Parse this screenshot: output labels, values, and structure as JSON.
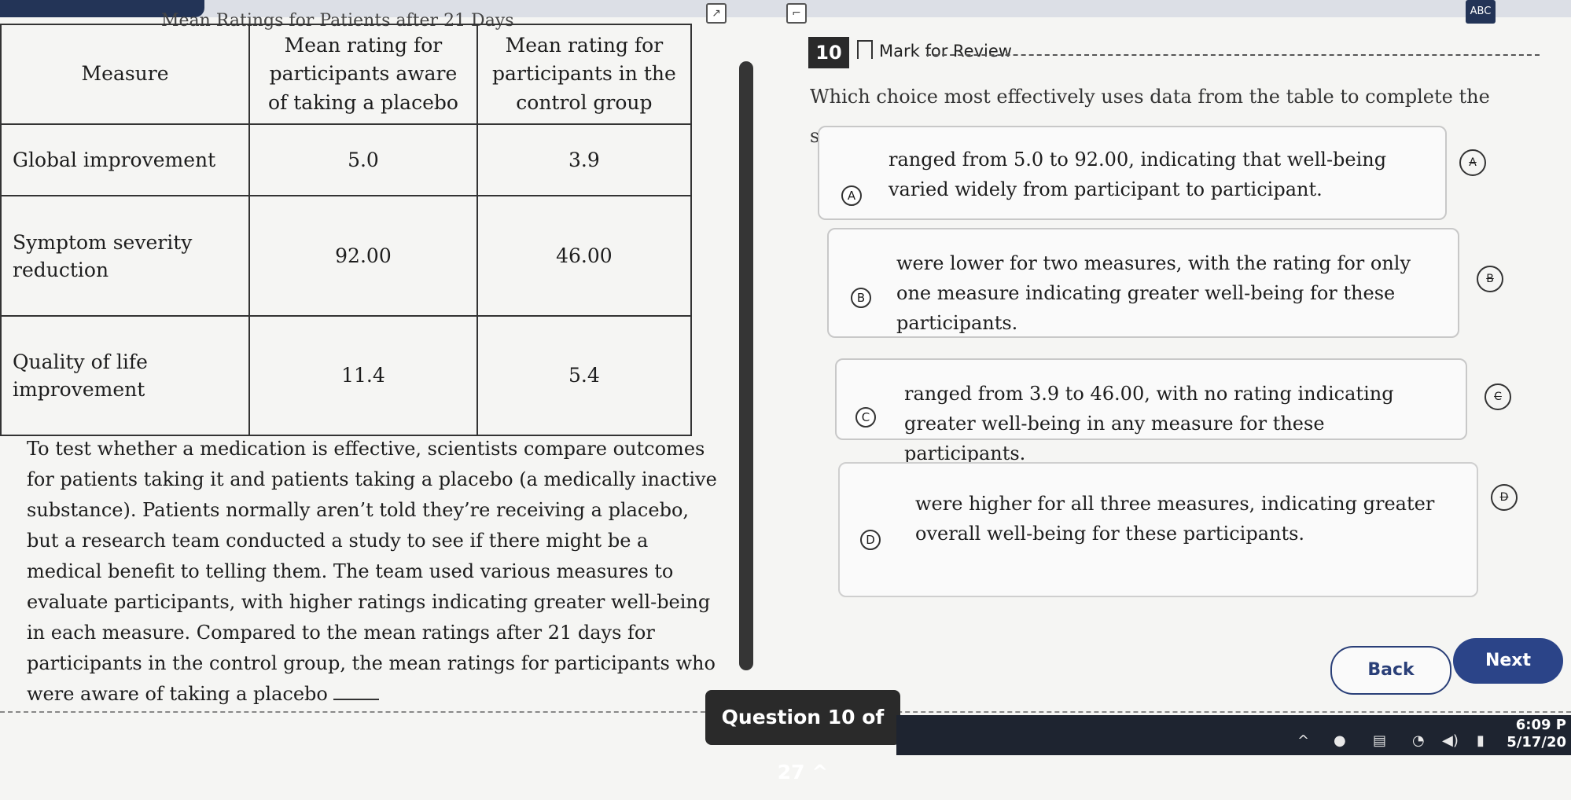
{
  "table": {
    "title": "Mean Ratings for Patients after 21 Days",
    "headers": [
      "Measure",
      "Mean rating for participants aware of taking a placebo",
      "Mean rating for participants in the control group"
    ],
    "rows": [
      {
        "measure": "Global improvement",
        "placebo": "5.0",
        "control": "3.9"
      },
      {
        "measure": "Symptom severity reduction",
        "placebo": "92.00",
        "control": "46.00"
      },
      {
        "measure": "Quality of life improvement",
        "placebo": "11.4",
        "control": "5.4"
      }
    ]
  },
  "passage": {
    "text": "To test whether a medication is effective, scientists compare outcomes for patients taking it and patients taking a placebo (a medically inactive substance). Patients normally aren’t told they’re receiving a placebo, but a research team conducted a study to see if there might be a medical benefit to telling them. The team used various measures to evaluate participants, with higher ratings indicating greater well-being in each measure. Compared to the mean ratings after 21 days for participants in the control group, the mean ratings for participants who were aware of taking a placebo"
  },
  "question": {
    "number": "10",
    "mark_label": "Mark for Review",
    "prompt": "Which choice most effectively uses data from the table to complete the statement?",
    "choices": [
      {
        "letter": "A",
        "text": "ranged from 5.0 to 92.00, indicating that well-being varied widely from participant to participant."
      },
      {
        "letter": "B",
        "text": "were lower for two measures, with the rating for only one measure indicating greater well-being for these participants."
      },
      {
        "letter": "C",
        "text": "ranged from 3.9 to 46.00, with no rating indicating greater well-being in any measure for these participants."
      },
      {
        "letter": "D",
        "text": "were higher for all three measures, indicating greater overall well-being for these participants."
      }
    ]
  },
  "toolbar": {
    "abc_label": "ABC",
    "expand_icon": "expand-icon",
    "collapse_icon": "collapse-icon"
  },
  "nav": {
    "back_label": "Back",
    "next_label": "Next",
    "progress_label": "Question 10 of 27 ^"
  },
  "taskbar": {
    "time": "6:09 P",
    "date": "5/17/20"
  },
  "colors": {
    "accent": "#2b4488",
    "dark": "#2a2a2a"
  }
}
